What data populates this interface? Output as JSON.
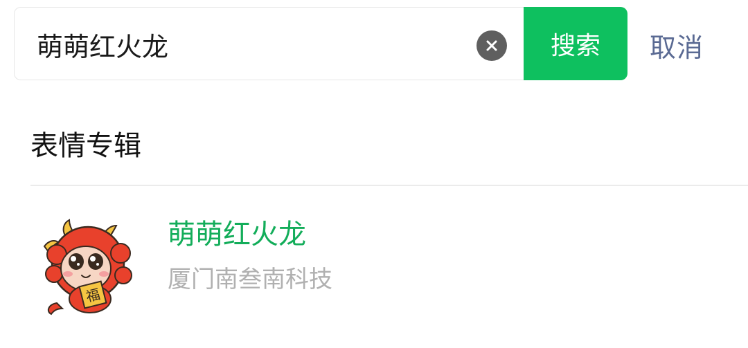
{
  "search": {
    "query": "萌萌红火龙",
    "button_label": "搜索",
    "cancel_label": "取消"
  },
  "section": {
    "title": "表情专辑"
  },
  "results": [
    {
      "title": "萌萌红火龙",
      "publisher": "厦门南叁南科技",
      "sticker_icon": "red-dragon-sticker",
      "sticker_badge_char": "福"
    }
  ],
  "colors": {
    "accent_green": "#0ec05f",
    "title_green": "#13ad5a",
    "cancel_blue": "#5a6a93",
    "dragon_red": "#e8412c"
  }
}
